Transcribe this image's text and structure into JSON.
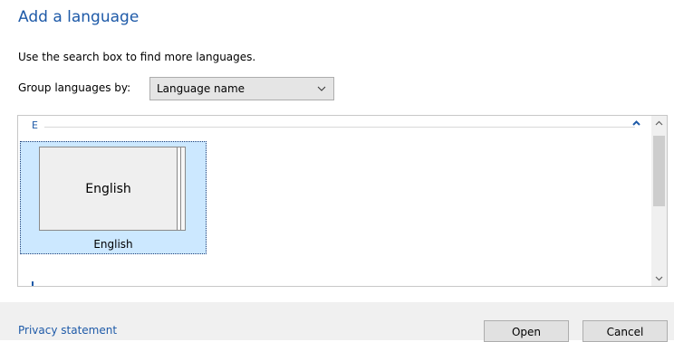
{
  "dialog": {
    "title": "Add a language",
    "instructions": "Use the search box to find more languages.",
    "group_by_label": "Group languages by:",
    "group_by_value": "Language name"
  },
  "list": {
    "group_header": "E",
    "items": [
      {
        "card_text": "English",
        "label": "English",
        "selected": true
      }
    ]
  },
  "footer": {
    "privacy_link": "Privacy statement",
    "open_button": "Open",
    "cancel_button": "Cancel"
  },
  "colors": {
    "accent": "#1e5aa8",
    "selection": "#cce8ff",
    "footer_bg": "#f0f0f0"
  },
  "icons": {
    "dropdown": "chevron-down-icon",
    "collapse": "chevron-up-icon",
    "scroll_up": "scroll-up-arrow-icon",
    "scroll_down": "scroll-down-arrow-icon"
  }
}
